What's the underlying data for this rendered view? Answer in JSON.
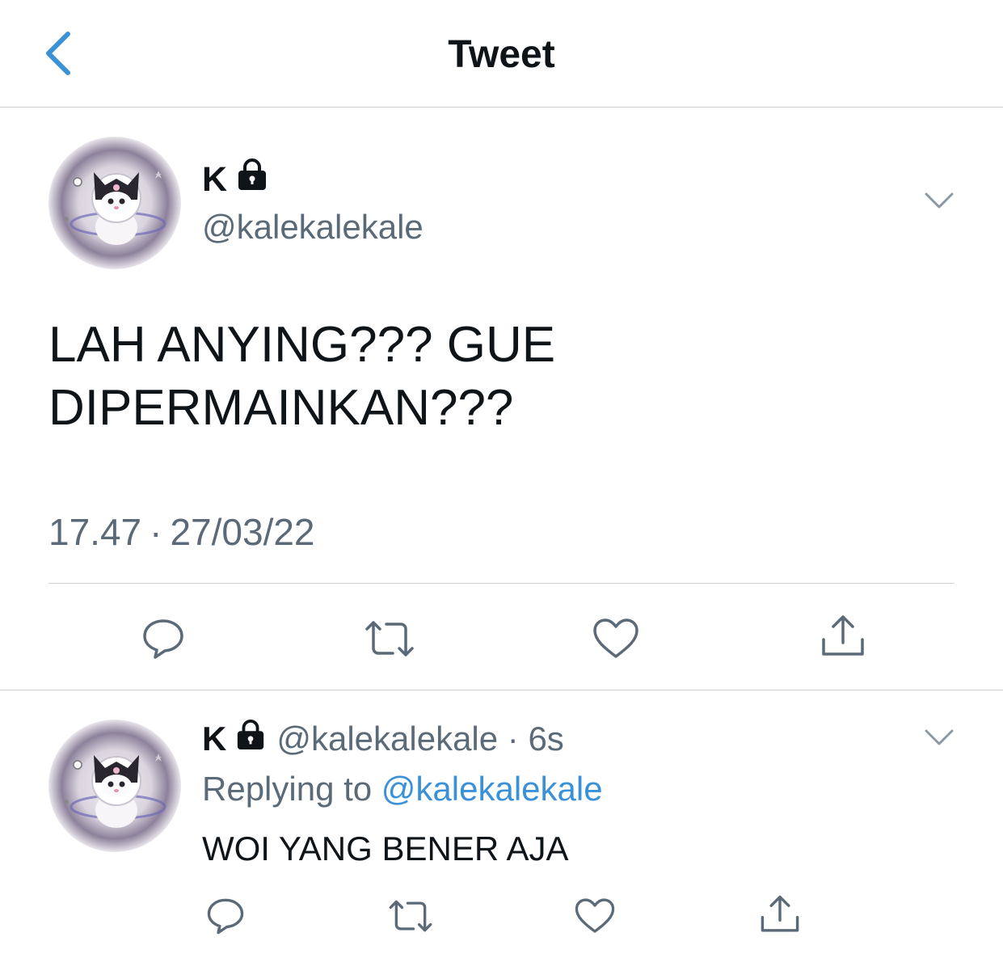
{
  "header": {
    "title": "Tweet"
  },
  "main_tweet": {
    "display_name": "K",
    "handle": "@kalekalekale",
    "text_line1": "LAH ANYING??? GUE",
    "text_line2": "DIPERMAINKAN???",
    "time": "17.47",
    "separator": "·",
    "date": "27/03/22"
  },
  "reply": {
    "display_name": "K",
    "handle": "@kalekalekale",
    "separator": " · ",
    "time": "6s",
    "replying_prefix": "Replying to ",
    "replying_handle": "@kalekalekale",
    "text": "WOI YANG BENER AJA"
  },
  "icons": {
    "back": "chevron-left-icon",
    "lock": "lock-icon",
    "more": "chevron-down-icon",
    "reply": "comment-icon",
    "retweet": "retweet-icon",
    "like": "heart-icon",
    "share": "share-icon"
  },
  "colors": {
    "accent": "#3a91d8",
    "secondary_text": "#5b6a78",
    "primary_text": "#0f1419",
    "divider": "#cfd4d9"
  }
}
